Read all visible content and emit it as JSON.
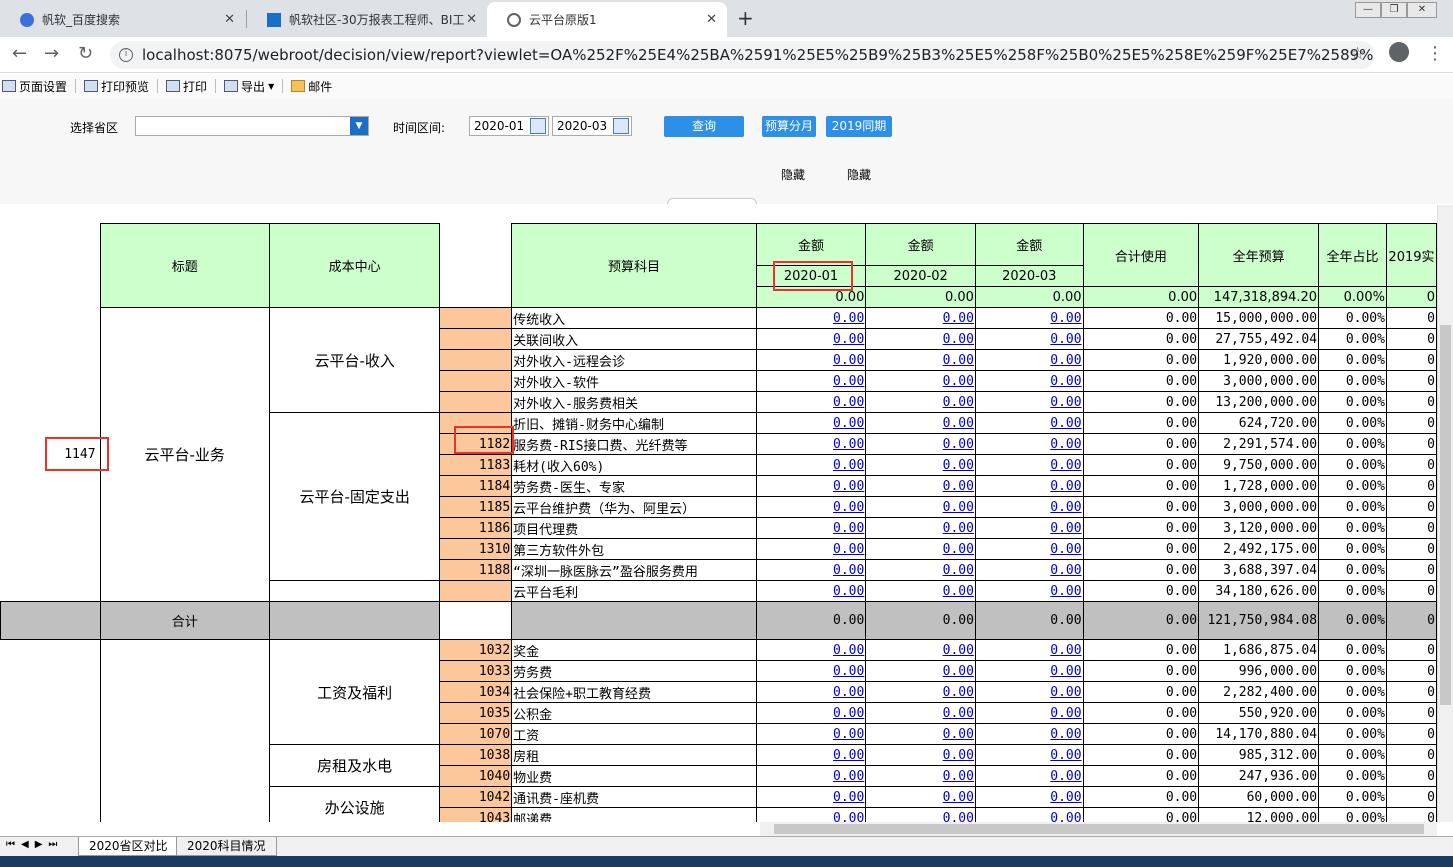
{
  "browser": {
    "tabs": [
      {
        "title": "帆软_百度搜索"
      },
      {
        "title": "帆软社区-30万报表工程师、BI工"
      },
      {
        "title": "云平台原版1"
      }
    ],
    "new_tab": "+",
    "url": "localhost:8075/webroot/decision/view/report?viewlet=OA%252F%25E4%25BA%2591%25E5%25B9%25B3%25E5%258F%25B0%25E5%258E%259F%25E7%2589%2588%2581.cpt&op..."
  },
  "toolbar": {
    "items": [
      "页面设置",
      "打印预览",
      "打印",
      "导出",
      "邮件"
    ]
  },
  "params": {
    "province_label": "选择省区",
    "province_value": "",
    "time_label": "时间区间:",
    "start": "2020-01",
    "end": "2020-03",
    "query": "查询",
    "budget_split": "预算分月",
    "same_period": "2019同期",
    "hide1": "隐藏",
    "hide2": "隐藏"
  },
  "report": {
    "headers": {
      "title": "标题",
      "cost_center": "成本中心",
      "subject": "预算科目",
      "amount": "金额",
      "months": [
        "2020-01",
        "2020-02",
        "2020-03"
      ],
      "total_use": "合计使用",
      "annual_budget": "全年预算",
      "annual_ratio": "全年占比",
      "prev": "2019实"
    },
    "summary_row": {
      "m1": "0.00",
      "m2": "0.00",
      "m3": "0.00",
      "total": "0.00",
      "budget": "147,318,894.20",
      "ratio": "0.00%",
      "prev": "0"
    },
    "row_label_id": "1147",
    "title_group": "云平台-业务",
    "groups": [
      "云平台-收入",
      "云平台-固定支出"
    ],
    "rows": [
      {
        "code": "",
        "subject": "传统收入",
        "m1": "0.00",
        "m2": "0.00",
        "m3": "0.00",
        "total": "0.00",
        "budget": "15,000,000.00",
        "ratio": "0.00%",
        "prev": "0"
      },
      {
        "code": "",
        "subject": "关联间收入",
        "m1": "0.00",
        "m2": "0.00",
        "m3": "0.00",
        "total": "0.00",
        "budget": "27,755,492.04",
        "ratio": "0.00%",
        "prev": "0"
      },
      {
        "code": "",
        "subject": "对外收入-远程会诊",
        "m1": "0.00",
        "m2": "0.00",
        "m3": "0.00",
        "total": "0.00",
        "budget": "1,920,000.00",
        "ratio": "0.00%",
        "prev": "0"
      },
      {
        "code": "",
        "subject": "对外收入-软件",
        "m1": "0.00",
        "m2": "0.00",
        "m3": "0.00",
        "total": "0.00",
        "budget": "3,000,000.00",
        "ratio": "0.00%",
        "prev": "0"
      },
      {
        "code": "",
        "subject": "对外收入-服务费相关",
        "m1": "0.00",
        "m2": "0.00",
        "m3": "0.00",
        "total": "0.00",
        "budget": "13,200,000.00",
        "ratio": "0.00%",
        "prev": "0"
      },
      {
        "code": "",
        "subject": "折旧、摊销-财务中心编制",
        "m1": "0.00",
        "m2": "0.00",
        "m3": "0.00",
        "total": "0.00",
        "budget": "624,720.00",
        "ratio": "0.00%",
        "prev": "0"
      },
      {
        "code": "1182",
        "subject": "服务费-RIS接口费、光纤费等",
        "m1": "0.00",
        "m2": "0.00",
        "m3": "0.00",
        "total": "0.00",
        "budget": "2,291,574.00",
        "ratio": "0.00%",
        "prev": "0"
      },
      {
        "code": "1183",
        "subject": "耗材(收入60%)",
        "m1": "0.00",
        "m2": "0.00",
        "m3": "0.00",
        "total": "0.00",
        "budget": "9,750,000.00",
        "ratio": "0.00%",
        "prev": "0"
      },
      {
        "code": "1184",
        "subject": "劳务费-医生、专家",
        "m1": "0.00",
        "m2": "0.00",
        "m3": "0.00",
        "total": "0.00",
        "budget": "1,728,000.00",
        "ratio": "0.00%",
        "prev": "0"
      },
      {
        "code": "1185",
        "subject": "云平台维护费（华为、阿里云）",
        "m1": "0.00",
        "m2": "0.00",
        "m3": "0.00",
        "total": "0.00",
        "budget": "3,000,000.00",
        "ratio": "0.00%",
        "prev": "0"
      },
      {
        "code": "1186",
        "subject": "项目代理费",
        "m1": "0.00",
        "m2": "0.00",
        "m3": "0.00",
        "total": "0.00",
        "budget": "3,120,000.00",
        "ratio": "0.00%",
        "prev": "0"
      },
      {
        "code": "1310",
        "subject": "第三方软件外包",
        "m1": "0.00",
        "m2": "0.00",
        "m3": "0.00",
        "total": "0.00",
        "budget": "2,492,175.00",
        "ratio": "0.00%",
        "prev": "0"
      },
      {
        "code": "1188",
        "subject": "“深圳一脉医脉云”盈谷服务费用",
        "m1": "0.00",
        "m2": "0.00",
        "m3": "0.00",
        "total": "0.00",
        "budget": "3,688,397.04",
        "ratio": "0.00%",
        "prev": "0"
      },
      {
        "code": "",
        "subject": "云平台毛利",
        "m1": "0.00",
        "m2": "0.00",
        "m3": "0.00",
        "total": "0.00",
        "budget": "34,180,626.00",
        "ratio": "0.00%",
        "prev": "0"
      }
    ],
    "total_row": {
      "label": "合计",
      "m1": "0.00",
      "m2": "0.00",
      "m3": "0.00",
      "total": "0.00",
      "budget": "121,750,984.08",
      "ratio": "0.00%",
      "prev": "0"
    },
    "groups2": [
      "工资及福利",
      "房租及水电",
      "办公设施"
    ],
    "rows2": [
      {
        "code": "1032",
        "subject": "奖金",
        "m1": "0.00",
        "m2": "0.00",
        "m3": "0.00",
        "total": "0.00",
        "budget": "1,686,875.04",
        "ratio": "0.00%",
        "prev": "0"
      },
      {
        "code": "1033",
        "subject": "劳务费",
        "m1": "0.00",
        "m2": "0.00",
        "m3": "0.00",
        "total": "0.00",
        "budget": "996,000.00",
        "ratio": "0.00%",
        "prev": "0"
      },
      {
        "code": "1034",
        "subject": "社会保险+职工教育经费",
        "m1": "0.00",
        "m2": "0.00",
        "m3": "0.00",
        "total": "0.00",
        "budget": "2,282,400.00",
        "ratio": "0.00%",
        "prev": "0"
      },
      {
        "code": "1035",
        "subject": "公积金",
        "m1": "0.00",
        "m2": "0.00",
        "m3": "0.00",
        "total": "0.00",
        "budget": "550,920.00",
        "ratio": "0.00%",
        "prev": "0"
      },
      {
        "code": "1070",
        "subject": "工资",
        "m1": "0.00",
        "m2": "0.00",
        "m3": "0.00",
        "total": "0.00",
        "budget": "14,170,880.04",
        "ratio": "0.00%",
        "prev": "0"
      },
      {
        "code": "1038",
        "subject": "房租",
        "m1": "0.00",
        "m2": "0.00",
        "m3": "0.00",
        "total": "0.00",
        "budget": "985,312.00",
        "ratio": "0.00%",
        "prev": "0"
      },
      {
        "code": "1040",
        "subject": "物业费",
        "m1": "0.00",
        "m2": "0.00",
        "m3": "0.00",
        "total": "0.00",
        "budget": "247,936.00",
        "ratio": "0.00%",
        "prev": "0"
      },
      {
        "code": "1042",
        "subject": "通讯费-座机费",
        "m1": "0.00",
        "m2": "0.00",
        "m3": "0.00",
        "total": "0.00",
        "budget": "60,000.00",
        "ratio": "0.00%",
        "prev": "0"
      },
      {
        "code": "1043",
        "subject": "邮递费",
        "m1": "0.00",
        "m2": "0.00",
        "m3": "0.00",
        "total": "0.00",
        "budget": "12,000.00",
        "ratio": "0.00%",
        "prev": "0"
      }
    ]
  },
  "sheets": [
    "2020省区对比",
    "2020科目情况"
  ],
  "sheet_nav": [
    "⏮",
    "◀",
    "▶",
    "⏭"
  ],
  "colors": {
    "header_green": "#ccffcc",
    "code_orange": "#fcc79a",
    "link_blue": "#0000cc",
    "highlight_red": "#e8322a",
    "button_blue": "#2e8fe6"
  }
}
